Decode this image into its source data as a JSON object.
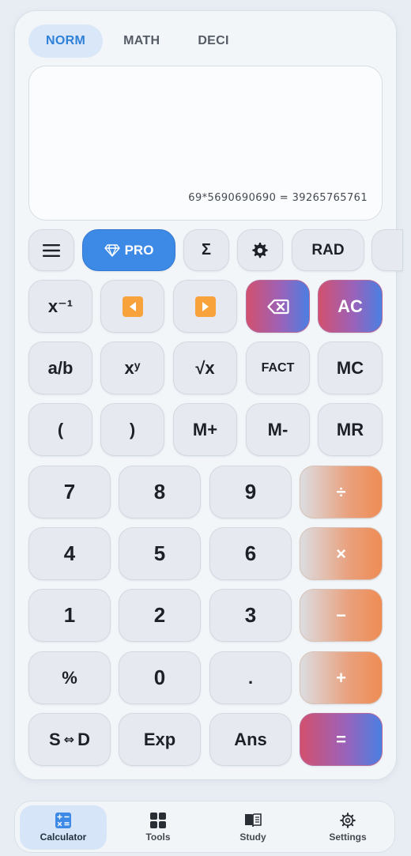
{
  "tabs": [
    {
      "label": "NORM",
      "active": true
    },
    {
      "label": "MATH",
      "active": false
    },
    {
      "label": "DECI",
      "active": false
    }
  ],
  "display": {
    "expression": "69*5690690690 = 39265765761"
  },
  "toolbar": {
    "menu_icon": "hamburger-menu-icon",
    "pro_label": "PRO",
    "sigma_label": "Σ",
    "settings_icon": "gear-icon",
    "angle_mode": "RAD"
  },
  "keys": {
    "inverse": "x⁻¹",
    "cursor_left_icon": "left-arrow-icon",
    "cursor_right_icon": "right-arrow-icon",
    "backspace_icon": "backspace-icon",
    "all_clear": "AC",
    "fraction": "a/b",
    "power_base": "x",
    "power_exp": "y",
    "sqrt": "√x",
    "factorial": "FACT",
    "memory_clear": "MC",
    "paren_open": "(",
    "paren_close": ")",
    "memory_plus": "M+",
    "memory_minus": "M-",
    "memory_recall": "MR",
    "seven": "7",
    "eight": "8",
    "nine": "9",
    "divide": "÷",
    "four": "4",
    "five": "5",
    "six": "6",
    "multiply": "×",
    "one": "1",
    "two": "2",
    "three": "3",
    "subtract": "−",
    "percent": "%",
    "zero": "0",
    "decimal": ".",
    "add": "+",
    "sd_s": "S",
    "sd_arrow": "⇔",
    "sd_d": "D",
    "exponent": "Exp",
    "answer": "Ans",
    "equals": "="
  },
  "bottom_nav": [
    {
      "label": "Calculator",
      "icon": "calculator-icon",
      "active": true
    },
    {
      "label": "Tools",
      "icon": "grid-icon",
      "active": false
    },
    {
      "label": "Study",
      "icon": "book-icon",
      "active": false
    },
    {
      "label": "Settings",
      "icon": "gear-icon",
      "active": false
    }
  ],
  "colors": {
    "accent": "#3d8ae6",
    "active_tab_bg": "#d9e7f8",
    "gradient_red_start": "#d2506e",
    "gradient_blue_end": "#4a7fe2",
    "operator_orange": "#ef8c54",
    "arrow_orange": "#f7a23a"
  }
}
